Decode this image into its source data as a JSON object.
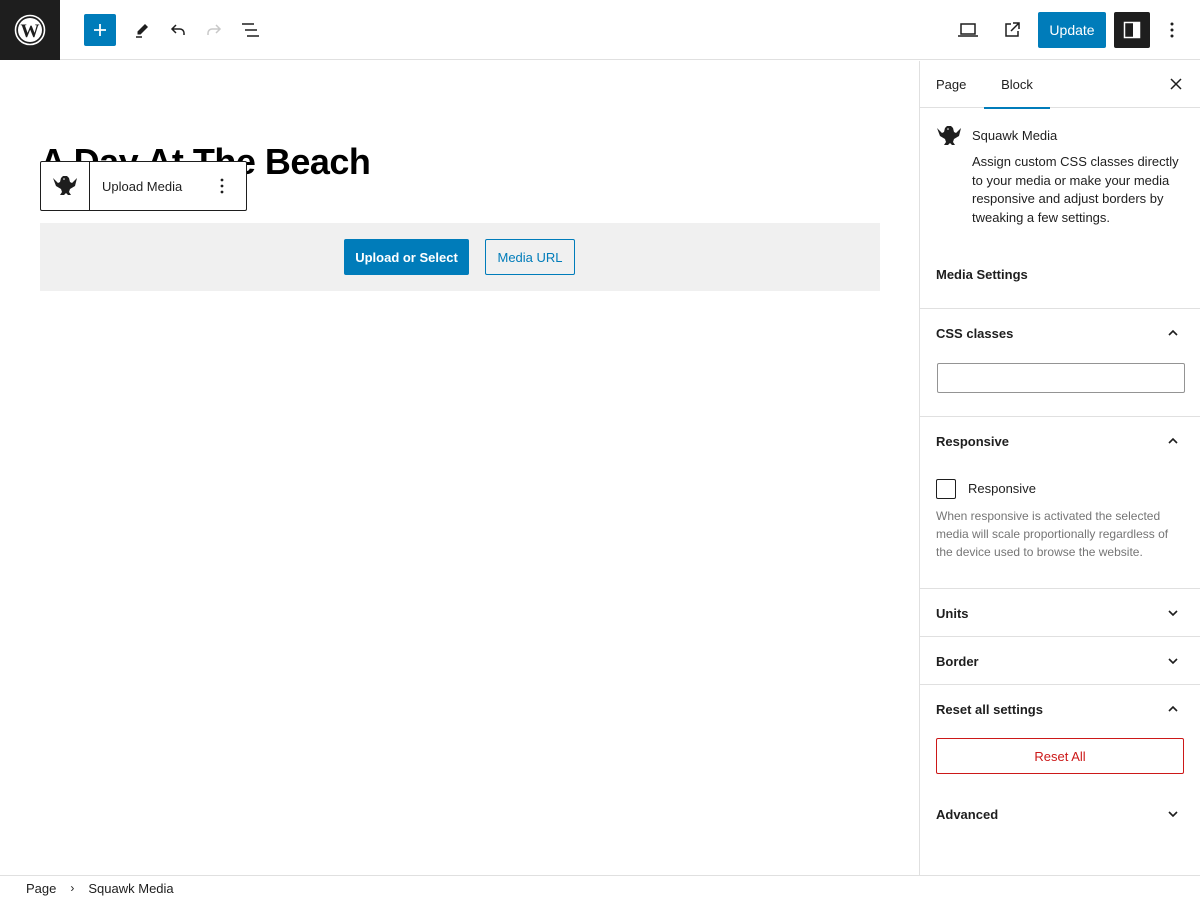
{
  "toolbar": {
    "logo": "wordpress-logo",
    "add_block_label": "Add block",
    "tools_label": "Tools",
    "undo_label": "Undo",
    "redo_label": "Redo",
    "list_view_label": "List view",
    "preview_label": "Preview",
    "view_page_label": "View page",
    "update_label": "Update",
    "settings_label": "Settings",
    "options_label": "Options"
  },
  "editor": {
    "page_title": "A Day At The Beach",
    "block_toolbar": {
      "block_icon": "squawk-bird-icon",
      "label": "Upload Media"
    },
    "placeholder": {
      "primary_button": "Upload or Select",
      "secondary_button": "Media URL"
    }
  },
  "sidebar": {
    "tabs": [
      {
        "label": "Page",
        "active": false
      },
      {
        "label": "Block",
        "active": true
      }
    ],
    "block_card": {
      "title": "Squawk Media",
      "description": "Assign custom CSS classes directly to your media or make your media responsive and adjust borders by tweaking a few settings."
    },
    "section_heading": "Media Settings",
    "panels": [
      {
        "title": "CSS classes",
        "expanded": true,
        "input_value": ""
      },
      {
        "title": "Responsive",
        "expanded": true,
        "checkbox_label": "Responsive",
        "checked": false,
        "help": "When responsive is activated the selected media will scale proportionally regardless of the device used to browse the website."
      },
      {
        "title": "Units",
        "expanded": false
      },
      {
        "title": "Border",
        "expanded": false
      },
      {
        "title": "Reset all settings",
        "expanded": true,
        "button": "Reset All"
      },
      {
        "title": "Advanced",
        "expanded": false
      }
    ]
  },
  "breadcrumb": {
    "items": [
      "Page",
      "Squawk Media"
    ],
    "separator": "›"
  },
  "colors": {
    "accent": "#007cba",
    "dark": "#1e1e1e",
    "danger": "#cc1818",
    "border": "#e0e0e0",
    "placeholder_bg": "#f0f0f0"
  }
}
